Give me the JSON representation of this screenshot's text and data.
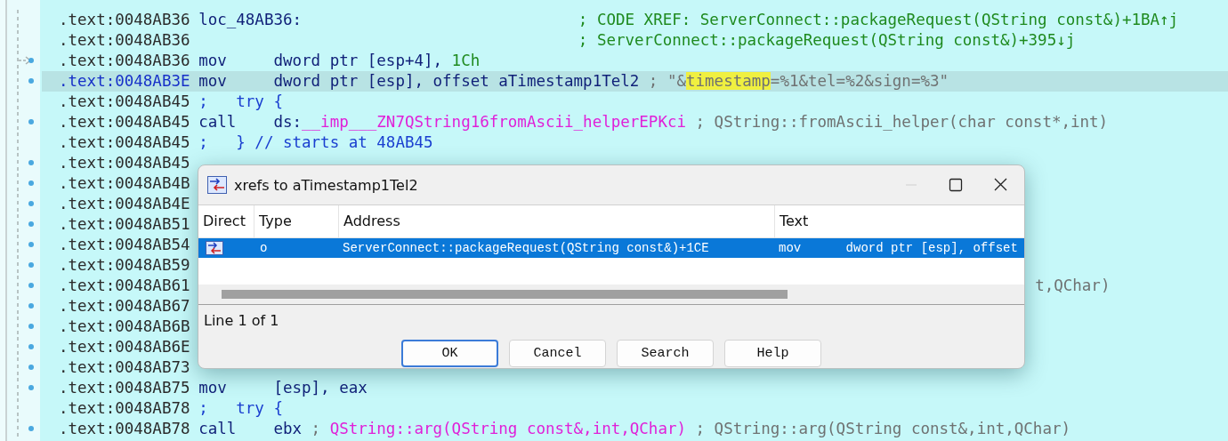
{
  "listing": [
    {
      "address": ".text:0048AB36",
      "selected": false,
      "arrow": false,
      "segments": [
        {
          "kind": "label",
          "text": "loc_48AB36:"
        },
        {
          "kind": "xref",
          "text": "; CODE XREF: ServerConnect::packageRequest(QString const&)+1BA↑j"
        }
      ]
    },
    {
      "address": ".text:0048AB36",
      "selected": false,
      "arrow": false,
      "segments": [
        {
          "kind": "spacer"
        },
        {
          "kind": "xref",
          "text": "; ServerConnect::packageRequest(QString const&)+395↓j"
        }
      ]
    },
    {
      "address": ".text:0048AB36",
      "selected": false,
      "arrow": true,
      "segments": [
        {
          "kind": "mnemonic",
          "text": "mov"
        },
        {
          "kind": "operand",
          "parts": [
            {
              "kind": "plain",
              "text": "dword ptr [esp+4], "
            },
            {
              "kind": "number",
              "text": "1Ch"
            }
          ]
        }
      ]
    },
    {
      "address": ".text:0048AB3E",
      "selected": true,
      "arrow": false,
      "segments": [
        {
          "kind": "mnemonic",
          "text": "mov"
        },
        {
          "kind": "operand",
          "text": "dword ptr [esp], offset aTimestamp1Tel2"
        },
        {
          "kind": "comment",
          "parts": [
            {
              "kind": "plain",
              "text": " ; \"&"
            },
            {
              "kind": "hit",
              "text": "timestamp"
            },
            {
              "kind": "plain",
              "text": "=%1&tel=%2&sign=%3\""
            }
          ]
        }
      ]
    },
    {
      "address": ".text:0048AB45",
      "selected": false,
      "arrow": false,
      "segments": [
        {
          "kind": "directive",
          "text": ";   try {"
        }
      ]
    },
    {
      "address": ".text:0048AB45",
      "selected": false,
      "arrow": false,
      "segments": [
        {
          "kind": "mnemonic",
          "text": "call"
        },
        {
          "kind": "operand",
          "parts": [
            {
              "kind": "plain",
              "text": "ds:"
            },
            {
              "kind": "import",
              "text": "__imp___ZN7QString16fromAscii_helperEPKci"
            }
          ]
        },
        {
          "kind": "comment",
          "text": " ; QString::fromAscii_helper(char const*,int)"
        }
      ]
    },
    {
      "address": ".text:0048AB45",
      "selected": false,
      "arrow": false,
      "segments": [
        {
          "kind": "directive",
          "text": ";   } // starts at 48AB45"
        }
      ]
    },
    {
      "address": ".text:0048AB45",
      "selected": false,
      "arrow": false
    },
    {
      "address": ".text:0048AB4B",
      "selected": false,
      "arrow": false
    },
    {
      "address": ".text:0048AB4E",
      "selected": false,
      "arrow": false
    },
    {
      "address": ".text:0048AB51",
      "selected": false,
      "arrow": false
    },
    {
      "address": ".text:0048AB54",
      "selected": false,
      "arrow": false
    },
    {
      "address": ".text:0048AB59",
      "selected": false,
      "arrow": false
    },
    {
      "address": ".text:0048AB61",
      "selected": false,
      "arrow": false,
      "segments": [
        {
          "kind": "tail",
          "text": "t,QChar)"
        }
      ]
    },
    {
      "address": ".text:0048AB67",
      "selected": false,
      "arrow": false
    },
    {
      "address": ".text:0048AB6B",
      "selected": false,
      "arrow": false
    },
    {
      "address": ".text:0048AB6E",
      "selected": false,
      "arrow": false
    },
    {
      "address": ".text:0048AB73",
      "selected": false,
      "arrow": false
    },
    {
      "address": ".text:0048AB75",
      "selected": false,
      "arrow": false,
      "segments": [
        {
          "kind": "mnemonic",
          "text": "mov"
        },
        {
          "kind": "operand",
          "text": "[esp], eax"
        }
      ]
    },
    {
      "address": ".text:0048AB78",
      "selected": false,
      "arrow": false,
      "segments": [
        {
          "kind": "directive",
          "text": ";   try {"
        }
      ]
    },
    {
      "address": ".text:0048AB78",
      "selected": false,
      "arrow": false,
      "segments": [
        {
          "kind": "mnemonic",
          "text": "call"
        },
        {
          "kind": "operand",
          "text": "ebx"
        },
        {
          "kind": "comment",
          "parts": [
            {
              "kind": "plain",
              "text": " ; "
            },
            {
              "kind": "import",
              "text": "QString::arg(QString const&,int,QChar)"
            },
            {
              "kind": "plain",
              "text": " ; QString::arg(QString const&,int,QChar)"
            }
          ]
        }
      ]
    }
  ],
  "dialog": {
    "title": "xrefs to aTimestamp1Tel2",
    "columns": [
      "Direct",
      "Type",
      "Address",
      "Text"
    ],
    "rows": [
      {
        "type": "o",
        "address": "ServerConnect::packageRequest(QString const&)+1CE",
        "text": "mov      dword ptr [esp], offset",
        "selected": true
      }
    ],
    "status": "Line 1 of 1",
    "buttons": [
      {
        "label": "OK",
        "default": true
      },
      {
        "label": "Cancel",
        "default": false
      },
      {
        "label": "Search",
        "default": false
      },
      {
        "label": "Help",
        "default": false
      }
    ]
  }
}
